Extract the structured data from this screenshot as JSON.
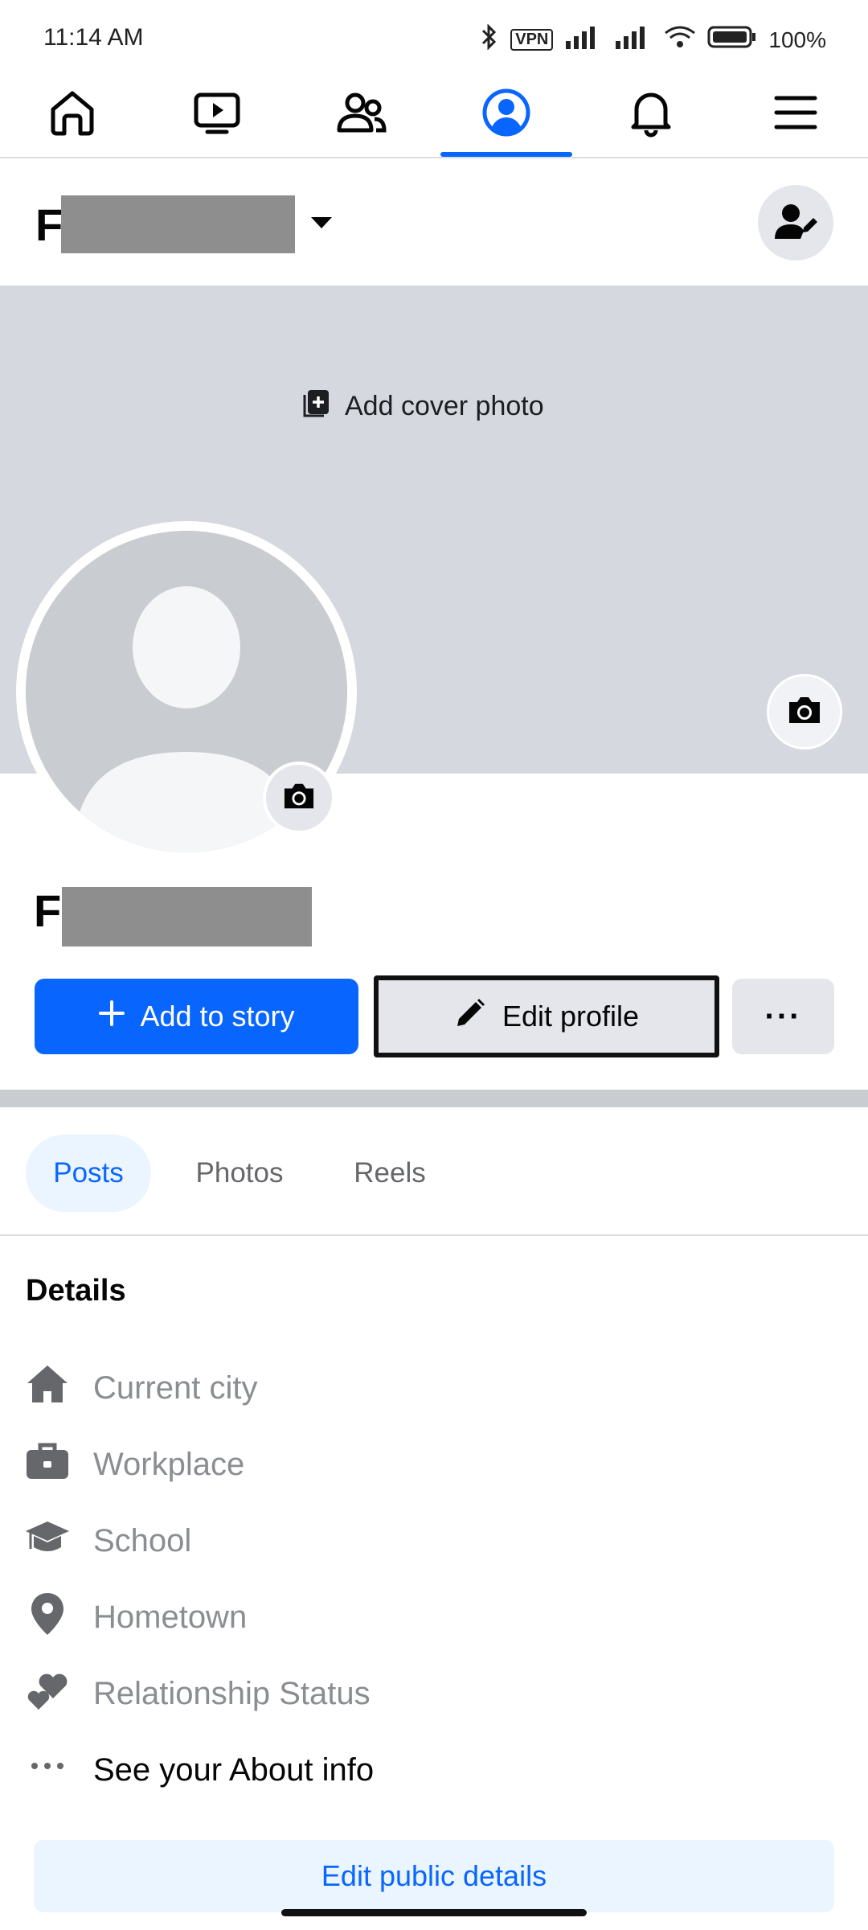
{
  "status_bar": {
    "time": "11:14 AM",
    "vpn": "VPN",
    "battery": "100%"
  },
  "nav": {
    "tabs": [
      "home-icon",
      "video-icon",
      "friends-icon",
      "profile-icon",
      "notifications-icon",
      "menu-icon"
    ],
    "active": "profile-icon",
    "accent": "#0866ff"
  },
  "header": {
    "name_initial": "F"
  },
  "cover": {
    "add_cover_label": "Add cover photo"
  },
  "profile": {
    "name_initial": "F"
  },
  "actions": {
    "add_story": "Add to story",
    "edit_profile": "Edit profile",
    "more": "···"
  },
  "tabs": {
    "posts": "Posts",
    "photos": "Photos",
    "reels": "Reels"
  },
  "details": {
    "title": "Details",
    "items": [
      {
        "icon": "house-icon",
        "label": "Current city"
      },
      {
        "icon": "briefcase-icon",
        "label": "Workplace"
      },
      {
        "icon": "graduation-cap-icon",
        "label": "School"
      },
      {
        "icon": "location-pin-icon",
        "label": "Hometown"
      },
      {
        "icon": "hearts-icon",
        "label": "Relationship Status"
      },
      {
        "icon": "more-dots-icon",
        "label": "See your About info"
      }
    ],
    "edit_public": "Edit public details"
  }
}
